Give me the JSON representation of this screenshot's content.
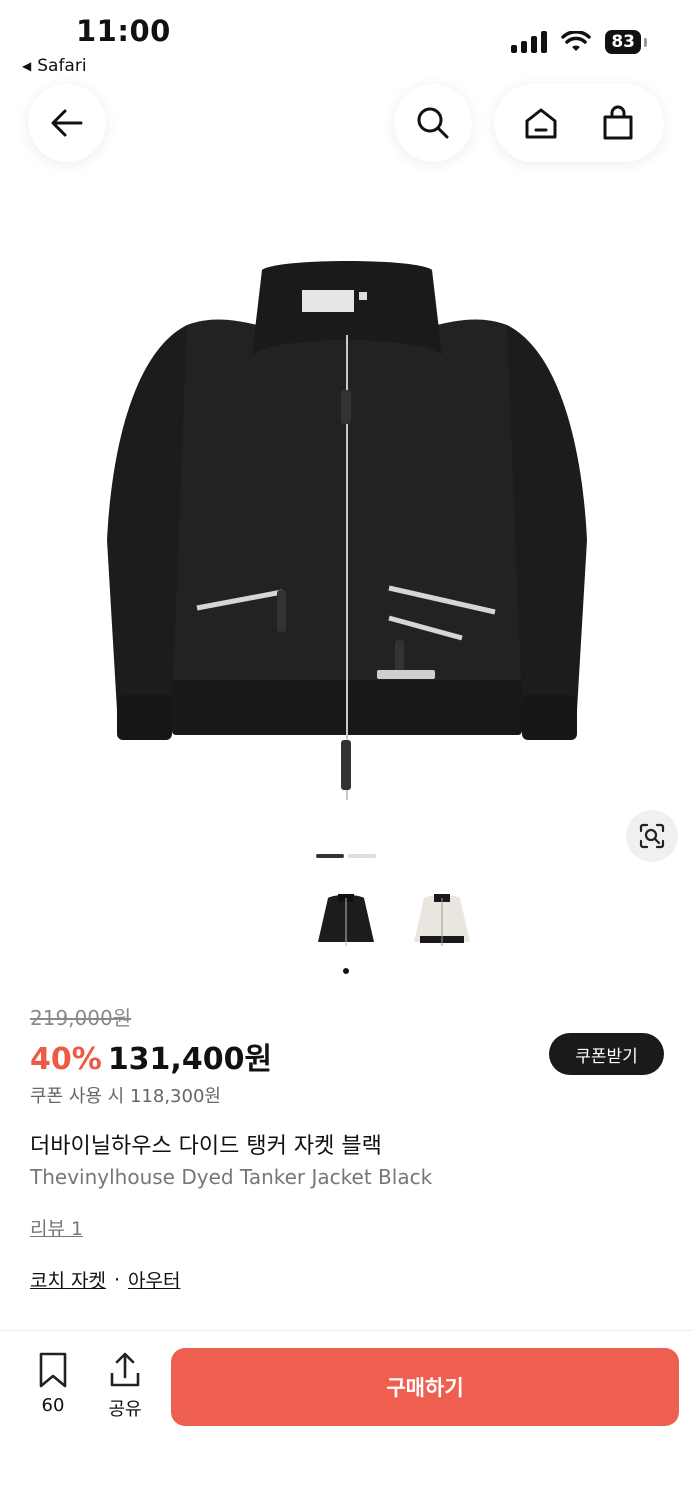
{
  "status_bar": {
    "time": "11:00",
    "back_app": "Safari",
    "battery": "83"
  },
  "product": {
    "original_price": "219,000원",
    "discount": "40%",
    "price": "131,400원",
    "coupon_button": "쿠폰받기",
    "coupon_price": "쿠폰 사용 시 118,300원",
    "title_ko": "더바이닐하우스 다이드 탱커 자켓 블랙",
    "title_en": "Thevinylhouse Dyed Tanker Jacket Black",
    "review_link": "리뷰 1",
    "category": {
      "primary": "코치 자켓",
      "separator": "·",
      "secondary": "아우터"
    }
  },
  "bottom_bar": {
    "bookmark_count": "60",
    "share_label": "공유",
    "buy_label": "구매하기"
  },
  "icons": {
    "back": "arrow-left-icon",
    "search": "search-icon",
    "home": "home-icon",
    "cart": "shopping-bag-icon",
    "lens": "visual-search-icon",
    "bookmark": "bookmark-icon",
    "share": "share-icon"
  },
  "colors": {
    "accent": "#ef5f4f",
    "discount": "#ef5a46",
    "dark": "#1a1a1a"
  }
}
